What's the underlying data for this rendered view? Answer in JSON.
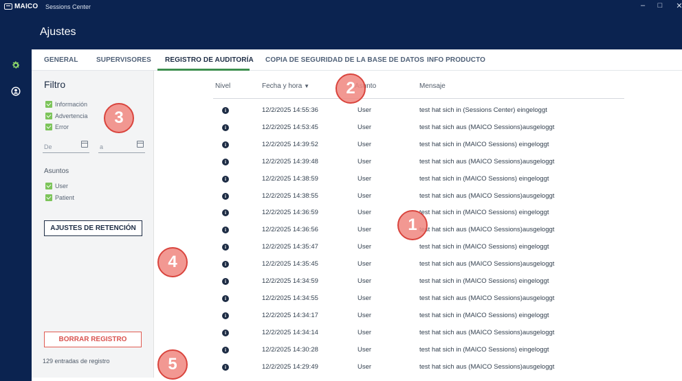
{
  "window": {
    "logo_text": "MAICO",
    "app_title": "Sessions Center",
    "controls": [
      "–",
      "□",
      "✕"
    ]
  },
  "header": {
    "title": "Ajustes"
  },
  "sidebar": {
    "items": [
      {
        "icon": "gear-icon",
        "active": true
      },
      {
        "icon": "user-icon",
        "active": false
      }
    ]
  },
  "tabs": [
    {
      "label": "GENERAL",
      "active": false
    },
    {
      "label": "SUPERVISORES",
      "active": false
    },
    {
      "label": "REGISTRO DE AUDITORÍA",
      "active": true
    },
    {
      "label": "COPIA DE SEGURIDAD DE LA BASE DE DATOS",
      "active": false
    },
    {
      "label": "INFO PRODUCTO",
      "active": false
    }
  ],
  "filter": {
    "title": "Filtro",
    "levels": [
      {
        "label": "Información",
        "checked": true
      },
      {
        "label": "Advertencia",
        "checked": true
      },
      {
        "label": "Error",
        "checked": true
      }
    ],
    "date_from_placeholder": "De",
    "date_to_placeholder": "a",
    "subjects_title": "Asuntos",
    "subjects": [
      {
        "label": "User",
        "checked": true
      },
      {
        "label": "Patient",
        "checked": true
      }
    ],
    "retention_button": "AJUSTES DE RETENCIÓN",
    "delete_button": "BORRAR REGISTRO",
    "entries_count": "129 entradas de registro"
  },
  "table": {
    "headers": {
      "level": "Nivel",
      "datetime": "Fecha y hora",
      "datetime_sort": "▼",
      "subject": "Asunto",
      "message": "Mensaje"
    },
    "rows": [
      {
        "level": "info",
        "datetime": "12/2/2025 14:55:36",
        "subject": "User",
        "message": "test hat sich in (Sessions Center) eingeloggt"
      },
      {
        "level": "info",
        "datetime": "12/2/2025 14:53:45",
        "subject": "User",
        "message": "test hat sich aus (MAICO Sessions)ausgeloggt"
      },
      {
        "level": "info",
        "datetime": "12/2/2025 14:39:52",
        "subject": "User",
        "message": "test hat sich in (MAICO Sessions) eingeloggt"
      },
      {
        "level": "info",
        "datetime": "12/2/2025 14:39:48",
        "subject": "User",
        "message": "test hat sich aus (MAICO Sessions)ausgeloggt"
      },
      {
        "level": "info",
        "datetime": "12/2/2025 14:38:59",
        "subject": "User",
        "message": "test hat sich in (MAICO Sessions) eingeloggt"
      },
      {
        "level": "info",
        "datetime": "12/2/2025 14:38:55",
        "subject": "User",
        "message": "test hat sich aus (MAICO Sessions)ausgeloggt"
      },
      {
        "level": "info",
        "datetime": "12/2/2025 14:36:59",
        "subject": "User",
        "message": "test hat sich in (MAICO Sessions) eingeloggt"
      },
      {
        "level": "info",
        "datetime": "12/2/2025 14:36:56",
        "subject": "User",
        "message": "test hat sich aus (MAICO Sessions)ausgeloggt"
      },
      {
        "level": "info",
        "datetime": "12/2/2025 14:35:47",
        "subject": "User",
        "message": "test hat sich in (MAICO Sessions) eingeloggt"
      },
      {
        "level": "info",
        "datetime": "12/2/2025 14:35:45",
        "subject": "User",
        "message": "test hat sich aus (MAICO Sessions)ausgeloggt"
      },
      {
        "level": "info",
        "datetime": "12/2/2025 14:34:59",
        "subject": "User",
        "message": "test hat sich in (MAICO Sessions) eingeloggt"
      },
      {
        "level": "info",
        "datetime": "12/2/2025 14:34:55",
        "subject": "User",
        "message": "test hat sich aus (MAICO Sessions)ausgeloggt"
      },
      {
        "level": "info",
        "datetime": "12/2/2025 14:34:17",
        "subject": "User",
        "message": "test hat sich in (MAICO Sessions) eingeloggt"
      },
      {
        "level": "info",
        "datetime": "12/2/2025 14:34:14",
        "subject": "User",
        "message": "test hat sich aus (MAICO Sessions)ausgeloggt"
      },
      {
        "level": "info",
        "datetime": "12/2/2025 14:30:28",
        "subject": "User",
        "message": "test hat sich in (MAICO Sessions) eingeloggt"
      },
      {
        "level": "info",
        "datetime": "12/2/2025 14:29:49",
        "subject": "User",
        "message": "test hat sich aus (MAICO Sessions)ausgeloggt"
      }
    ]
  },
  "callouts": [
    "1",
    "2",
    "3",
    "4",
    "5"
  ],
  "colors": {
    "navy": "#0b2350",
    "accent_green": "#3d8f4e",
    "checkbox_green": "#7cc45a",
    "delete_red": "#d9534f",
    "callout_fill": "#f08780"
  }
}
